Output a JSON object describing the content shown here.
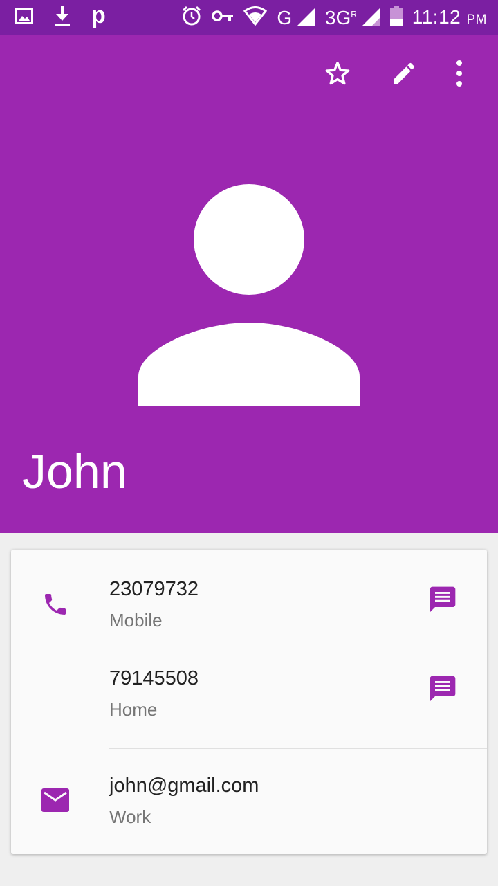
{
  "status_bar": {
    "icons_left": [
      "image-icon",
      "download-icon",
      "p-notification-icon"
    ],
    "p_label": "p",
    "icons_right": [
      "alarm-icon",
      "vpn-key-icon",
      "wifi-icon",
      "signal-g-icon",
      "signal-3g-roaming-icon",
      "battery-icon"
    ],
    "network_g": "G",
    "network_3g": "3G",
    "roaming": "R",
    "time": "11:12",
    "ampm": "PM"
  },
  "header": {
    "actions": [
      "star-icon",
      "edit-pencil-icon",
      "more-vert-icon"
    ],
    "contact_name": "John",
    "avatar": "person-placeholder-icon"
  },
  "details": {
    "phones": [
      {
        "number": "23079732",
        "type": "Mobile"
      },
      {
        "number": "79145508",
        "type": "Home"
      }
    ],
    "email": {
      "address": "john@gmail.com",
      "type": "Work"
    }
  },
  "colors": {
    "status_bar": "#7b1fa2",
    "header": "#9c27b0",
    "accent": "#9c27b0",
    "card": "#fafafa",
    "background": "#efefef",
    "primary_text": "#212121",
    "secondary_text": "#757575"
  }
}
